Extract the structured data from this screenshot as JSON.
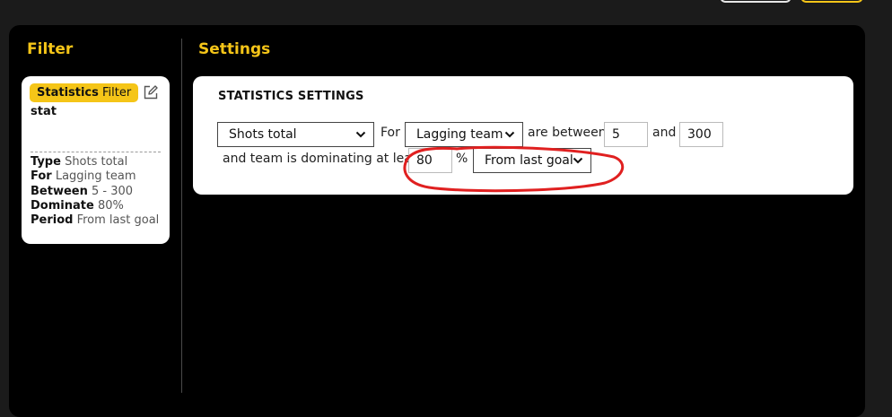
{
  "filter": {
    "title": "Filter",
    "card": {
      "chip_bold": "Statistics",
      "chip_rest": "Filter",
      "name": "stat",
      "details": [
        {
          "key": "Type",
          "value": "Shots total"
        },
        {
          "key": "For",
          "value": "Lagging team"
        },
        {
          "key": "Between",
          "value": "5 - 300"
        },
        {
          "key": "Dominate",
          "value": "80%"
        },
        {
          "key": "Period",
          "value": "From last goal"
        }
      ]
    }
  },
  "settings": {
    "title": "Settings",
    "card_title": "STATISTICS SETTINGS",
    "stat_select": "Shots total",
    "for_label": "For",
    "team_select": "Lagging team",
    "between_label": "are between",
    "min_value": "5",
    "and_label": "and",
    "max_value": "300",
    "dominating_label": "and team is dominating at least",
    "dominate_value": "80",
    "percent_label": "%",
    "period_select": "From last goal"
  },
  "colors": {
    "accent": "#f5c518",
    "annotation": "#e02020"
  }
}
